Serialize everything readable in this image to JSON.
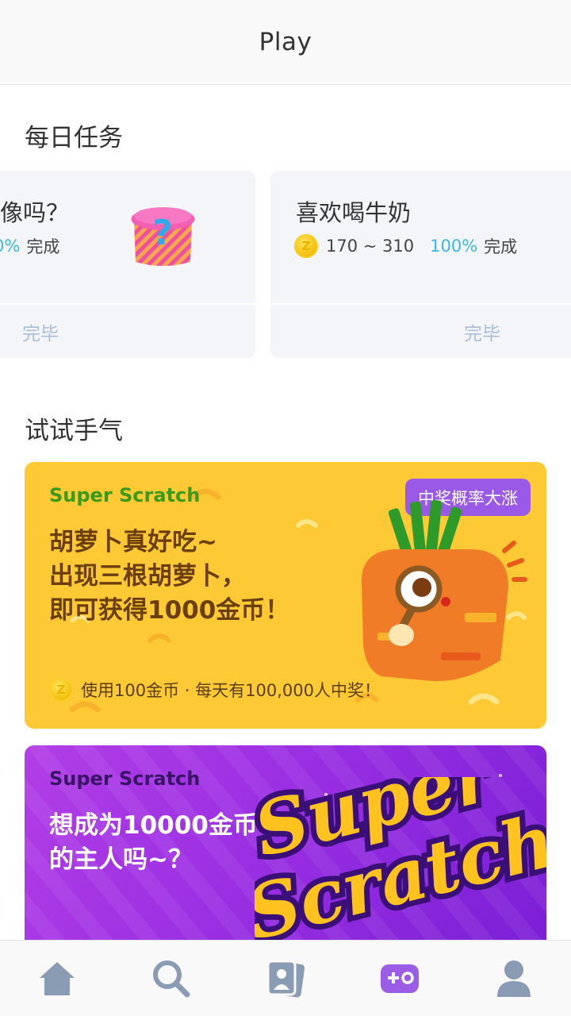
{
  "header": {
    "title": "Play"
  },
  "daily_tasks": {
    "title": "每日任务",
    "cards": [
      {
        "name": "像吗？",
        "percent": "0%",
        "status": "完成",
        "button": "完毕",
        "icon": "mystery-gift-box-icon"
      },
      {
        "name": "喜欢喝牛奶",
        "reward": "170 ~ 310",
        "percent": "100%",
        "status": "完成",
        "button": "完毕",
        "icon": "coin-icon"
      }
    ]
  },
  "try_luck": {
    "title": "试试手气",
    "banners": [
      {
        "kicker": "Super Scratch",
        "headline": [
          "胡萝卜真好吃~",
          "出现三根胡萝卜，",
          "即可获得1000金币！"
        ],
        "badge": "中奖概率大涨",
        "footer": "使用100金币 · 每天有100,000人中奖！",
        "image": "carrot-with-magnifier-icon",
        "kicker_color": "#3a9a1c",
        "headline_color": "#6b3e0d"
      },
      {
        "kicker": "Super Scratch",
        "headline": [
          "想成为10000金币",
          "的主人吗~？"
        ],
        "logo_text": [
          "Super",
          "Scratch"
        ],
        "kicker_color": "#3a1466",
        "headline_color": "#ffffff"
      }
    ]
  },
  "tabbar": {
    "items": [
      {
        "icon": "home-icon"
      },
      {
        "icon": "search-icon"
      },
      {
        "icon": "cards-icon"
      },
      {
        "icon": "gamepad-icon",
        "active": true
      },
      {
        "icon": "profile-icon"
      }
    ],
    "inactive_color": "#8a9cb3",
    "active_color": "#9b5de5"
  }
}
